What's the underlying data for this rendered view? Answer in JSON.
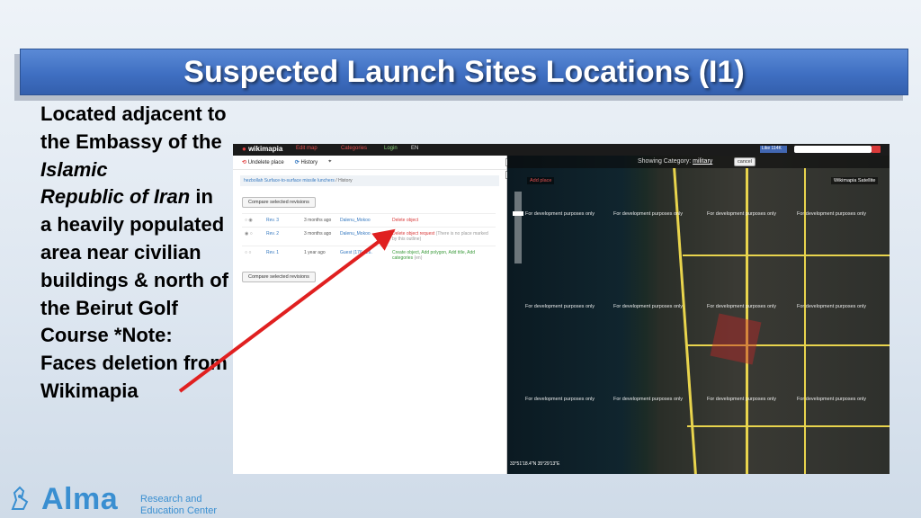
{
  "slide": {
    "title": "Suspected Launch Sites Locations (I1)",
    "text_a": "Located adjacent to the Embassy of the ",
    "text_italic_1": "Islamic",
    "text_italic_2": "Republic of Iran",
    "text_b": " in a heavily populated area near civilian buildings & north of the Beirut Golf Course *Note: Faces deletion from Wikimapia",
    "arrow_color": "#e02020",
    "title_color": "#3f6fc2"
  },
  "logo": {
    "name": "Alma",
    "subtitle_1": "Research and",
    "subtitle_2": "Education Center",
    "color": "#3a8fd1"
  },
  "wikimapia": {
    "brand": "wikimapia",
    "menu": [
      {
        "label": "Edit map",
        "style": "red"
      },
      {
        "label": "Categories",
        "style": "red"
      },
      {
        "label": "Login",
        "style": "green"
      },
      {
        "label": "EN",
        "style": "white"
      }
    ],
    "like_label": "Like 114K",
    "side_actions": [
      "Undelete place",
      "History"
    ],
    "breadcrumb_link": "hezbollah Surface-to-surface missile lunchers",
    "breadcrumb_current": "History",
    "compare_label": "Compare selected revisions",
    "revisions": [
      {
        "rev": "Rev. 3",
        "age": "3 months ago",
        "user": "Dalenu_Mokoo",
        "action": "Delete object",
        "action_style": "red",
        "note": ""
      },
      {
        "rev": "Rev. 2",
        "age": "3 months ago",
        "user": "Dalenu_Mokoo",
        "action": "Delete object request",
        "action_style": "red",
        "note": "(There is no place marked by this outline)"
      },
      {
        "rev": "Rev. 1",
        "age": "1 year ago",
        "user": "Guest (176.126.",
        "action": "Create object, Add polygon, Add title, Add categories",
        "action_style": "green",
        "note": "(en)"
      }
    ],
    "map": {
      "showing_label": "Showing Category:",
      "category": "military",
      "cancel_label": "cancel",
      "add_place": "Add place",
      "layer_label": "Wikimapia Satellite",
      "dev_text": "For development purposes only",
      "coords": "33°51'18.4\"N 35°29'13\"E"
    }
  }
}
